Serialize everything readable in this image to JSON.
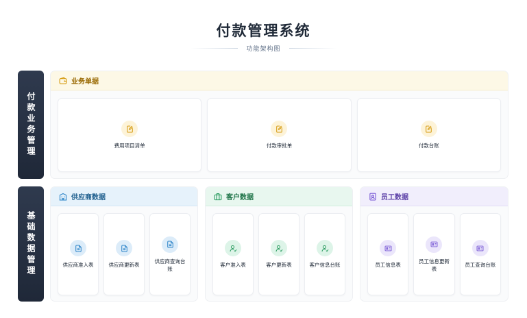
{
  "title": "付款管理系统",
  "subtitle": "功能架构图",
  "sections": [
    {
      "label": "付款业务管理"
    },
    {
      "label": "基础数据管理"
    }
  ],
  "groups": {
    "documents": {
      "title": "业务单据",
      "color": "#d59a0e",
      "items": [
        "费用项目清单",
        "付款审批单",
        "付款台账"
      ]
    },
    "supplier": {
      "title": "供应商数据",
      "color": "#2f86c9",
      "items": [
        "供应商准入表",
        "供应商更新表",
        "供应商查询台账"
      ]
    },
    "customer": {
      "title": "客户数据",
      "color": "#2f9e63",
      "items": [
        "客户准入表",
        "客户更新表",
        "客户信息台账"
      ]
    },
    "employee": {
      "title": "员工数据",
      "color": "#7b5cd6",
      "items": [
        "员工信息表",
        "员工信息更新表",
        "员工查询台账"
      ]
    }
  },
  "icons": {
    "documents_header": "wallet-icon",
    "documents_item": "edit-document-icon",
    "supplier_header": "building-icon",
    "supplier_item": "document-icon",
    "customer_header": "briefcase-icon",
    "customer_item": "user-check-icon",
    "employee_header": "id-badge-icon",
    "employee_item": "id-card-icon"
  }
}
